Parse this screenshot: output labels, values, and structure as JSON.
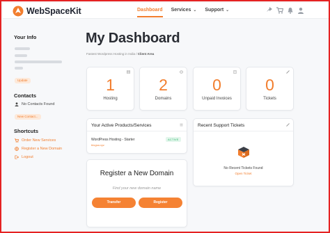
{
  "brand": {
    "name": "WebSpaceKit",
    "accent": "#f27e2e"
  },
  "nav": [
    {
      "label": "Dashboard",
      "active": true
    },
    {
      "label": "Services",
      "caret": "⌄"
    },
    {
      "label": "Support",
      "caret": "⌄"
    }
  ],
  "header_icons": [
    "share-icon",
    "cart-icon",
    "bell-icon",
    "user-icon"
  ],
  "sidebar": {
    "info_title": "Your Info",
    "update_label": "Update",
    "contacts_title": "Contacts",
    "no_contacts": "No Contacts Found",
    "new_contact_label": "New Contact...",
    "shortcuts_title": "Shortcuts",
    "shortcuts": [
      {
        "label": "Order New Services",
        "icon": "cart-icon"
      },
      {
        "label": "Register a New Domain",
        "icon": "globe-icon"
      },
      {
        "label": "Logout",
        "icon": "logout-icon"
      }
    ]
  },
  "main": {
    "title": "My Dashboard",
    "breadcrumb_site": "Fastest Wordpress Hosting in India",
    "breadcrumb_sep": " / ",
    "breadcrumb_current": "Client Area",
    "stats": [
      {
        "value": "1",
        "label": "Hosting",
        "icon": "server-icon"
      },
      {
        "value": "2",
        "label": "Domains",
        "icon": "globe-icon"
      },
      {
        "value": "0",
        "label": "Unpaid Invoices",
        "icon": "invoice-icon"
      },
      {
        "value": "0",
        "label": "Tickets",
        "icon": "ticket-icon"
      }
    ],
    "products": {
      "title": "Your Active Products/Services",
      "items": [
        {
          "name": "WordPress Hosting - Starter",
          "domain": "blogsa.xyz",
          "status": "ACTIVE"
        }
      ]
    },
    "tickets": {
      "title": "Recent Support Tickets",
      "empty": "No Recent Tickets Found",
      "open_label": "Open Ticket"
    },
    "register": {
      "title": "Register a New Domain",
      "placeholder": "Find your new domain name",
      "transfer_label": "Transfer",
      "register_label": "Register"
    }
  }
}
